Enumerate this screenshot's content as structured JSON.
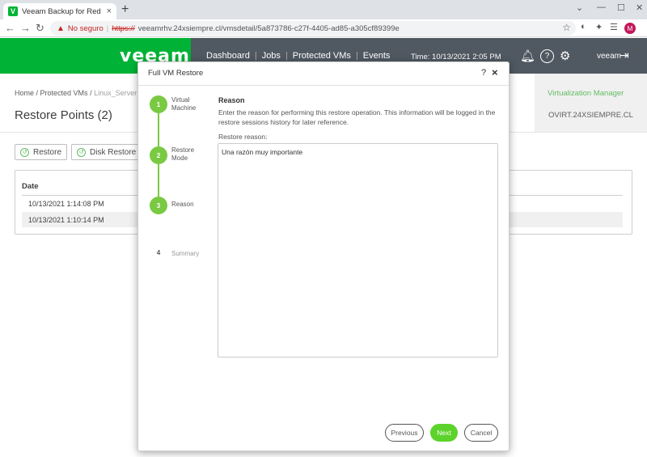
{
  "browser": {
    "tab_title": "Veeam Backup for Red Hat Virtu",
    "tab_close": "×",
    "new_tab": "+",
    "insecure_label": "No seguro",
    "url_scheme": "https://",
    "url_rest": "veeamrhv.24xsiempre.cl/vmsdetail/5a873786-c27f-4405-ad85-a305cf89399e",
    "profile_initial": "M"
  },
  "header": {
    "logo": "veeam",
    "nav": [
      "Dashboard",
      "Jobs",
      "Protected VMs",
      "Events"
    ],
    "time": "Time: 10/13/2021 2:05 PM",
    "user": "veeam"
  },
  "page": {
    "breadcrumb_home": "Home",
    "breadcrumb_protected": "Protected VMs",
    "breadcrumb_current": "Linux_Server",
    "title": "Restore Points (2)",
    "virtualization_label": "Virtualization Manager",
    "virtualization_value": "OVIRT.24XSIEMPRE.CL",
    "toolbar": {
      "restore": "Restore",
      "disk_restore": "Disk Restore"
    },
    "table": {
      "header": "Date",
      "rows": [
        "10/13/2021 1:14:08 PM",
        "10/13/2021 1:10:14 PM"
      ]
    }
  },
  "modal": {
    "title": "Full VM Restore",
    "help": "?",
    "close": "×",
    "steps": [
      {
        "num": "1",
        "label": "Virtual\nMachine",
        "state": "done"
      },
      {
        "num": "2",
        "label": "Restore\nMode",
        "state": "done"
      },
      {
        "num": "3",
        "label": "Reason",
        "state": "active"
      },
      {
        "num": "4",
        "label": "Summary",
        "state": "pending"
      }
    ],
    "section_title": "Reason",
    "section_desc": "Enter the reason for performing this restore operation. This information will be logged in the restore sessions history for later reference.",
    "field_label": "Restore reason:",
    "reason_value": "Una razón muy importante",
    "buttons": {
      "previous": "Previous",
      "next": "Next",
      "cancel": "Cancel"
    }
  }
}
